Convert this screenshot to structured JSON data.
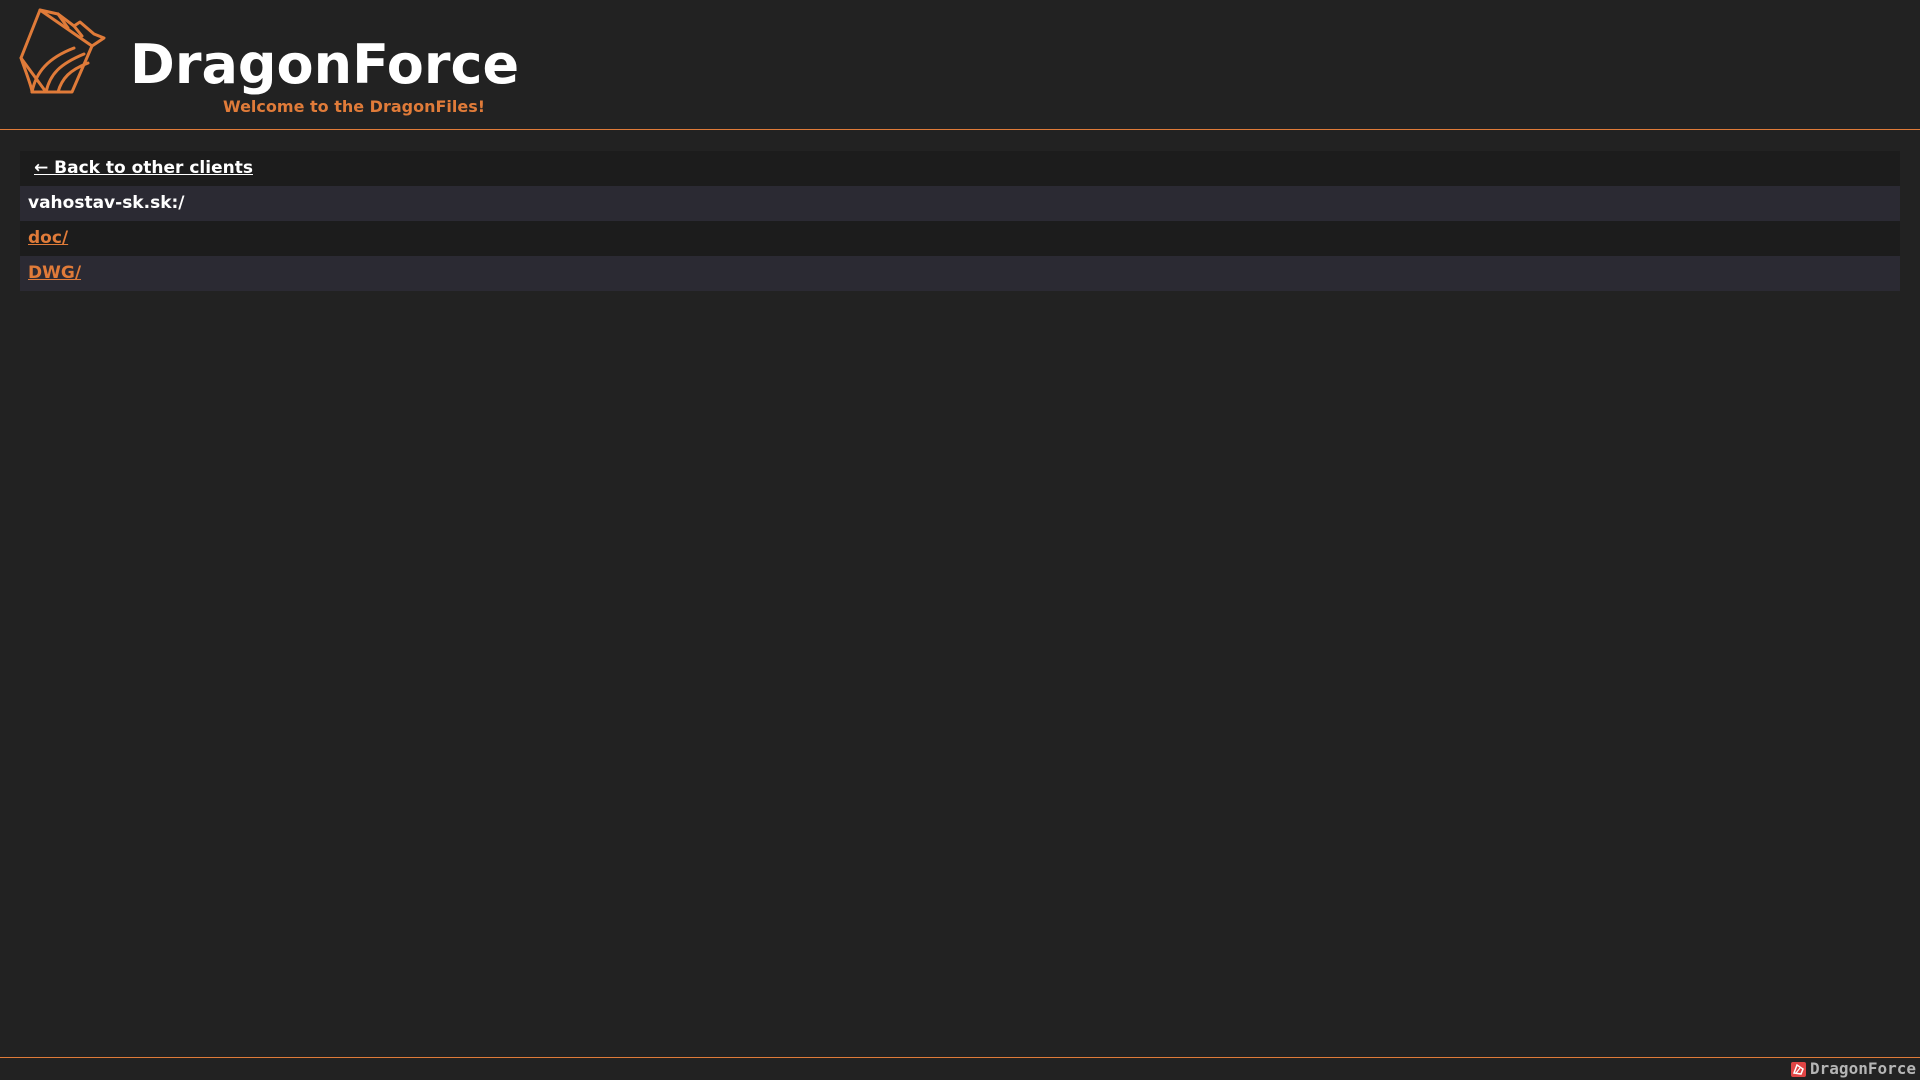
{
  "header": {
    "title": "DragonForce",
    "subtitle": "Welcome to the DragonFiles!",
    "logo_icon": "dragon-logo-icon"
  },
  "listing": {
    "back_label": "← Back to other clients",
    "path": "vahostav-sk.sk:/",
    "entries": [
      {
        "label": "doc/"
      },
      {
        "label": "DWG/"
      }
    ]
  },
  "footer": {
    "brand": "DragonForce",
    "icon": "dragon-small-icon"
  },
  "colors": {
    "background": "#222222",
    "accent": "#e07b39",
    "row_dark": "#1c1c1c",
    "row_alt": "#2b2a33"
  }
}
